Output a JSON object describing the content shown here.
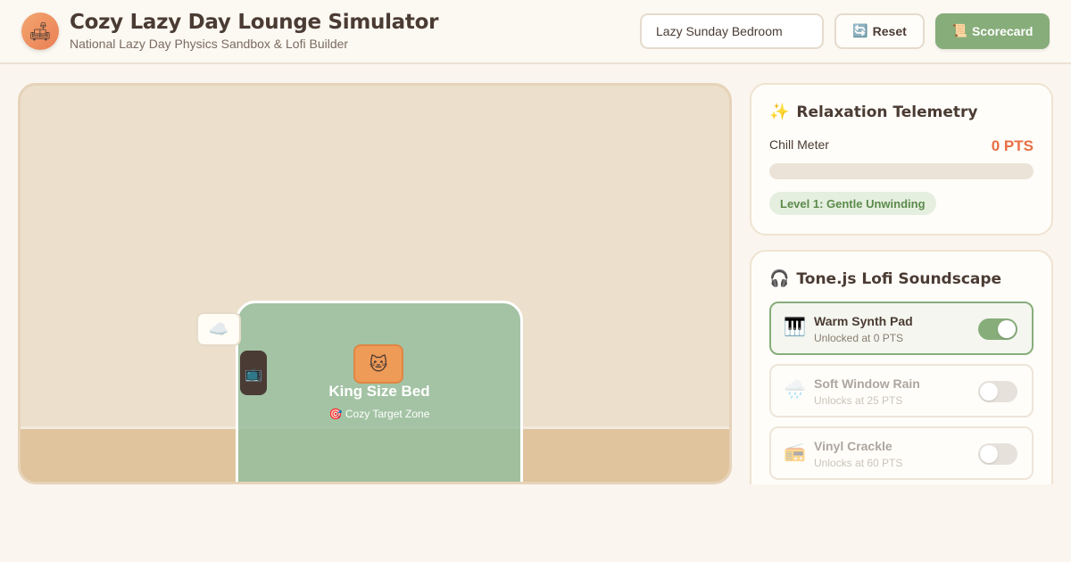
{
  "header": {
    "logo_icon": "🛋",
    "title": "Cozy Lazy Day Lounge Simulator",
    "subtitle": "National Lazy Day Physics Sandbox & Lofi Builder",
    "scene_value": "Lazy Sunday Bedroom",
    "reset_icon": "🔄",
    "reset_label": "Reset",
    "scorecard_icon": "📜",
    "scorecard_label": "Scorecard"
  },
  "stage": {
    "bed_icon": "🐱",
    "bed_title": "King Size Bed",
    "bed_sub_icon": "🎯",
    "bed_subtitle": "Cozy Target Zone",
    "cloud_icon": "☁️",
    "tv_icon": "📺"
  },
  "telemetry": {
    "icon": "✨",
    "title": "Relaxation Telemetry",
    "chill_label": "Chill Meter",
    "points": "0 PTS",
    "meter_fraction": 0,
    "level": "Level 1: Gentle Unwinding"
  },
  "soundscape": {
    "icon": "🎧",
    "title": "Tone.js Lofi Soundscape",
    "tracks": [
      {
        "icon": "🎹",
        "name": "Warm Synth Pad",
        "status": "Unlocked at 0 PTS",
        "on": true
      },
      {
        "icon": "🌧️",
        "name": "Soft Window Rain",
        "status": "Unlocks at 25 PTS",
        "on": false
      },
      {
        "icon": "📻",
        "name": "Vinyl Crackle",
        "status": "Unlocks at 60 PTS",
        "on": false
      }
    ]
  },
  "colors": {
    "accent_green": "#87ad7b",
    "accent_orange": "#e86f45",
    "background": "#faf5ee"
  }
}
